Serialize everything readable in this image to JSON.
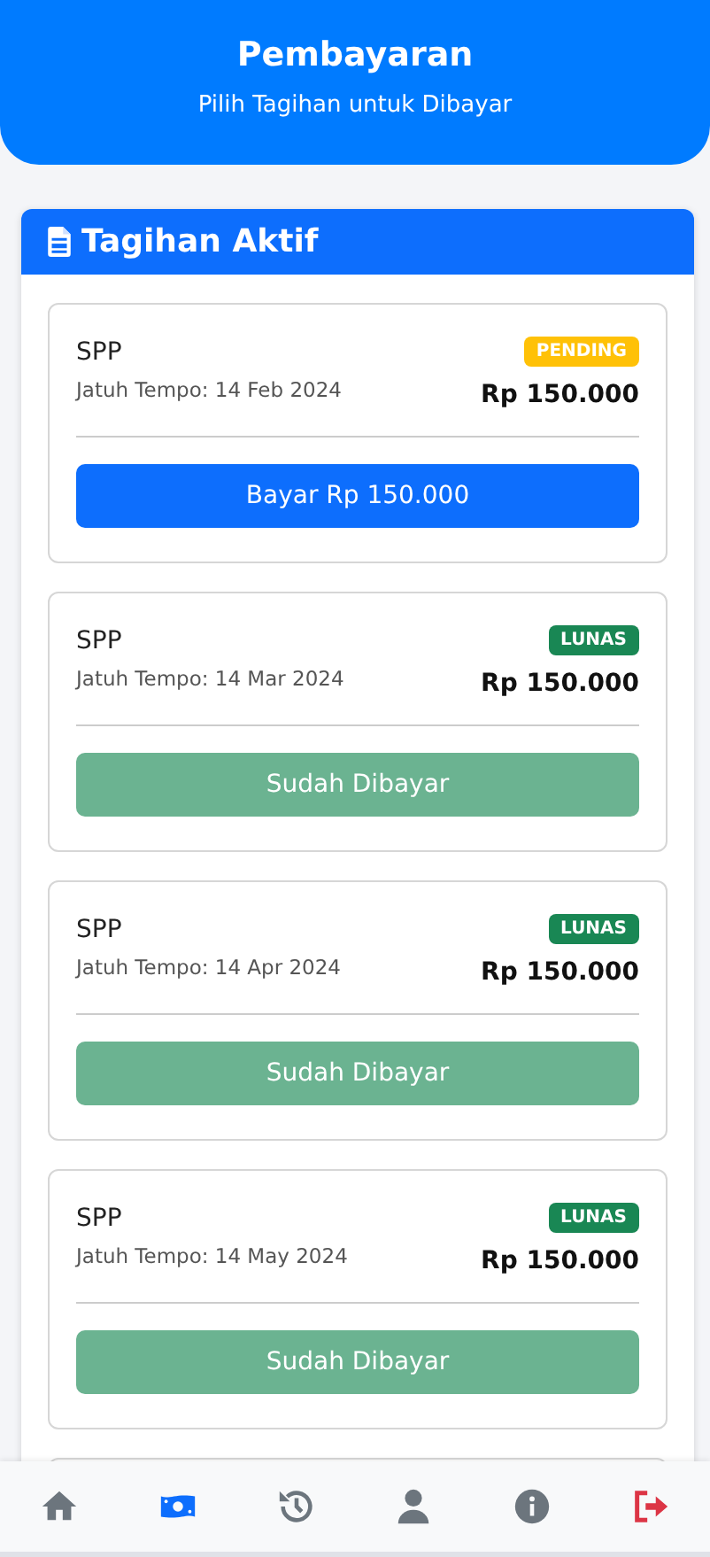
{
  "header": {
    "title": "Pembayaran",
    "subtitle": "Pilih Tagihan untuk Dibayar"
  },
  "panel": {
    "title": "Tagihan Aktif"
  },
  "bills": [
    {
      "name": "SPP",
      "due": "Jatuh Tempo: 14 Feb 2024",
      "amount": "Rp 150.000",
      "kind": "pending",
      "badge": "PENDING",
      "action": "Bayar Rp 150.000"
    },
    {
      "name": "SPP",
      "due": "Jatuh Tempo: 14 Mar 2024",
      "amount": "Rp 150.000",
      "kind": "paid",
      "badge": "LUNAS",
      "action": "Sudah Dibayar"
    },
    {
      "name": "SPP",
      "due": "Jatuh Tempo: 14 Apr 2024",
      "amount": "Rp 150.000",
      "kind": "paid",
      "badge": "LUNAS",
      "action": "Sudah Dibayar"
    },
    {
      "name": "SPP",
      "due": "Jatuh Tempo: 14 May 2024",
      "amount": "Rp 150.000",
      "kind": "paid",
      "badge": "LUNAS",
      "action": "Sudah Dibayar"
    }
  ],
  "nav": [
    {
      "kind": "home",
      "selected": false
    },
    {
      "kind": "payment",
      "selected": true
    },
    {
      "kind": "history",
      "selected": false
    },
    {
      "kind": "profile",
      "selected": false
    },
    {
      "kind": "info",
      "selected": false
    },
    {
      "kind": "logout",
      "selected": false
    }
  ]
}
